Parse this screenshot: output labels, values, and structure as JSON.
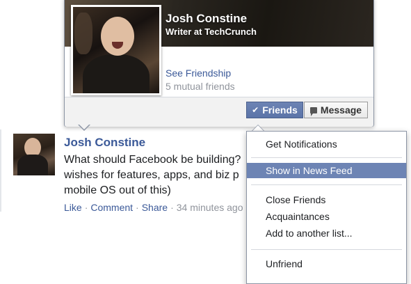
{
  "hovercard": {
    "name": "Josh Constine",
    "subtitle": "Writer at TechCrunch",
    "see_friendship_link": "See Friendship",
    "mutual_friends": "5 mutual friends",
    "friends_button": "Friends",
    "message_button": "Message",
    "friends_check_glyph": "✔"
  },
  "story": {
    "author": "Josh Constine",
    "text": "What should Facebook be building? wishes for features, apps, and biz p mobile OS out of this)",
    "actions": {
      "like": "Like",
      "comment": "Comment",
      "share": "Share",
      "timestamp": "34 minutes ago"
    }
  },
  "friends_menu": {
    "items": [
      {
        "label": "Get Notifications",
        "active": false
      },
      {
        "label": "Show in News Feed",
        "active": true
      },
      {
        "label": "Close Friends",
        "active": false
      },
      {
        "label": "Acquaintances",
        "active": false
      },
      {
        "label": "Add to another list...",
        "active": false
      },
      {
        "label": "Unfriend",
        "active": false
      }
    ]
  },
  "colors": {
    "link_blue": "#3b5998",
    "menu_highlight": "#6d84b4",
    "friends_button": "#6d84b4"
  },
  "icons": [
    "check-icon",
    "speech-bubble-icon"
  ]
}
